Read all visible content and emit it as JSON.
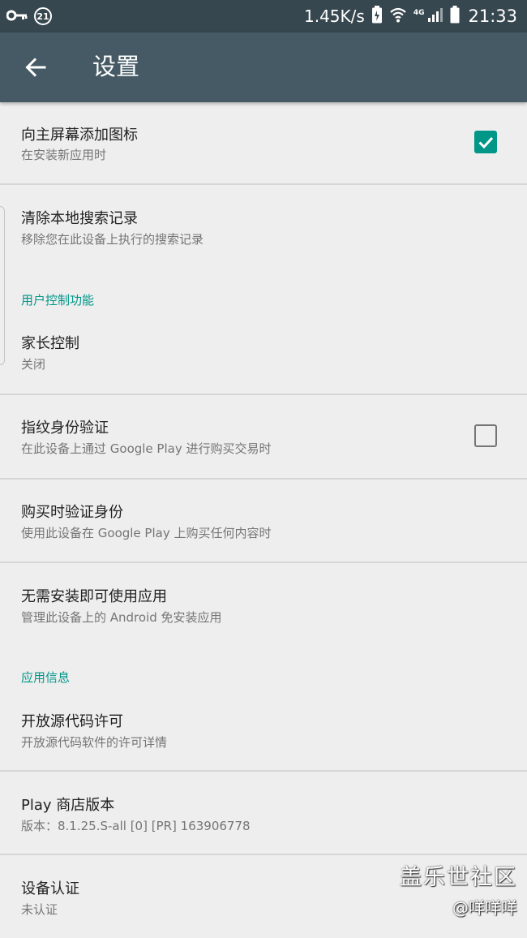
{
  "status_bar": {
    "notification_count": "21",
    "network_speed": "1.45K/s",
    "network_type": "4G",
    "time": "21:33"
  },
  "app_bar": {
    "title": "设置"
  },
  "settings": {
    "add_icon": {
      "title": "向主屏幕添加图标",
      "summary": "在安装新应用时",
      "checked": true
    },
    "clear_history": {
      "title": "清除本地搜索记录",
      "summary": "移除您在此设备上执行的搜索记录"
    },
    "user_controls_header": "用户控制功能",
    "parental_controls": {
      "title": "家长控制",
      "summary": "关闭"
    },
    "fingerprint": {
      "title": "指纹身份验证",
      "summary": "在此设备上通过 Google Play 进行购买交易时",
      "checked": false
    },
    "require_auth": {
      "title": "购买时验证身份",
      "summary": "使用此设备在 Google Play 上购买任何内容时"
    },
    "instant_apps": {
      "title": "无需安装即可使用应用",
      "summary": "管理此设备上的 Android 免安装应用"
    },
    "about_header": "应用信息",
    "open_source": {
      "title": "开放源代码许可",
      "summary": "开放源代码软件的许可详情"
    },
    "play_version": {
      "title": "Play 商店版本",
      "summary": "版本：8.1.25.S-all [0] [PR] 163906778"
    },
    "device_cert": {
      "title": "设备认证",
      "summary": "未认证"
    }
  },
  "watermark": {
    "brand": "盖乐世社区",
    "user": "@咩咩咩"
  },
  "colors": {
    "status_bar": "#37474f",
    "app_bar": "#455a64",
    "accent": "#009688",
    "background": "#eeeeee",
    "divider": "#d6d6d6"
  }
}
